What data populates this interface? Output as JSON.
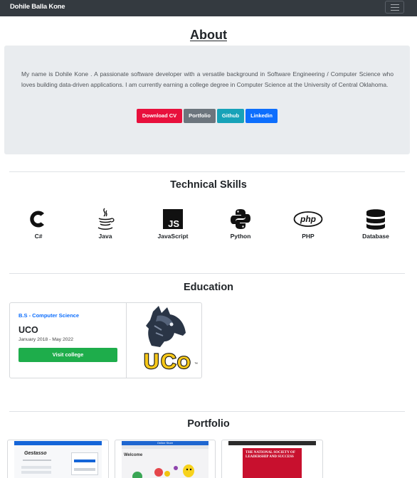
{
  "navbar": {
    "brand": "Dohile Balla Kone",
    "menu_icon": "hamburger-icon"
  },
  "about": {
    "title": "About",
    "bio": "My name is Dohile Kone . A passionate software developer with a versatile background in Software Engineering / Computer Science who loves building data-driven applications. I am currently earning a college degree in Computer Science at the University of Central Oklahoma.",
    "buttons": [
      {
        "label": "Download CV",
        "color": "#e8103c"
      },
      {
        "label": "Portfolio",
        "color": "#6c757d"
      },
      {
        "label": "Github",
        "color": "#17a2b8"
      },
      {
        "label": "Linkedin",
        "color": "#0d6efd"
      }
    ]
  },
  "skills": {
    "title": "Technical Skills",
    "items": [
      {
        "label": "C#",
        "icon": "csharp-icon"
      },
      {
        "label": "Java",
        "icon": "java-icon"
      },
      {
        "label": "JavaScript",
        "icon": "javascript-icon"
      },
      {
        "label": "Python",
        "icon": "python-icon"
      },
      {
        "label": "PHP",
        "icon": "php-icon"
      },
      {
        "label": "Database",
        "icon": "database-icon"
      }
    ]
  },
  "education": {
    "title": "Education",
    "degree": "B.S - Computer Science",
    "school": "UCO",
    "dates": "January 2018 - May 2022",
    "visit_label": "Visit college",
    "logo_text": "UCO"
  },
  "portfolio": {
    "title": "Portfolio",
    "cards": [
      {
        "name": "Gestasso",
        "heading": "Gestasso",
        "icon": "project-thumbnail"
      },
      {
        "name": "Online Store",
        "heading": "Online Store",
        "welcome": "Welcome",
        "icon": "project-thumbnail"
      },
      {
        "name": "The National Society of Leadership and Success",
        "heading": "THE NATIONAL SOCIETY OF LEADERSHIP AND SUCCESS",
        "icon": "project-thumbnail"
      }
    ]
  }
}
